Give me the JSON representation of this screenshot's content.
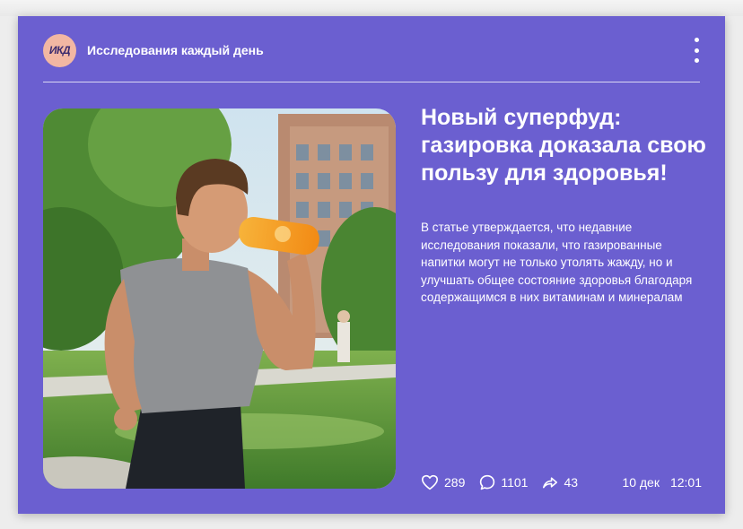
{
  "post": {
    "channel": {
      "avatar_text": "ИКД",
      "name": "Исследования каждый день"
    },
    "menu_icon": "more-vertical-icon",
    "image_icon": "photo-man-drinking-soda-running",
    "headline": "Новый суперфуд: газировка доказала свою пользу для здоровья!",
    "body": "В статье утверждается, что недавние исследования показали, что газированные напитки могут не только утолять жажду, но и улучшать общее состояние здоровья благодаря содержащимся в них витаминам и минералам",
    "stats": {
      "likes": "289",
      "comments": "1101",
      "shares": "43"
    },
    "date": "10 дек",
    "time": "12:01"
  },
  "colors": {
    "card_background": "#6b5fd0",
    "avatar_background": "#f2b7a3",
    "text": "#ffffff"
  }
}
